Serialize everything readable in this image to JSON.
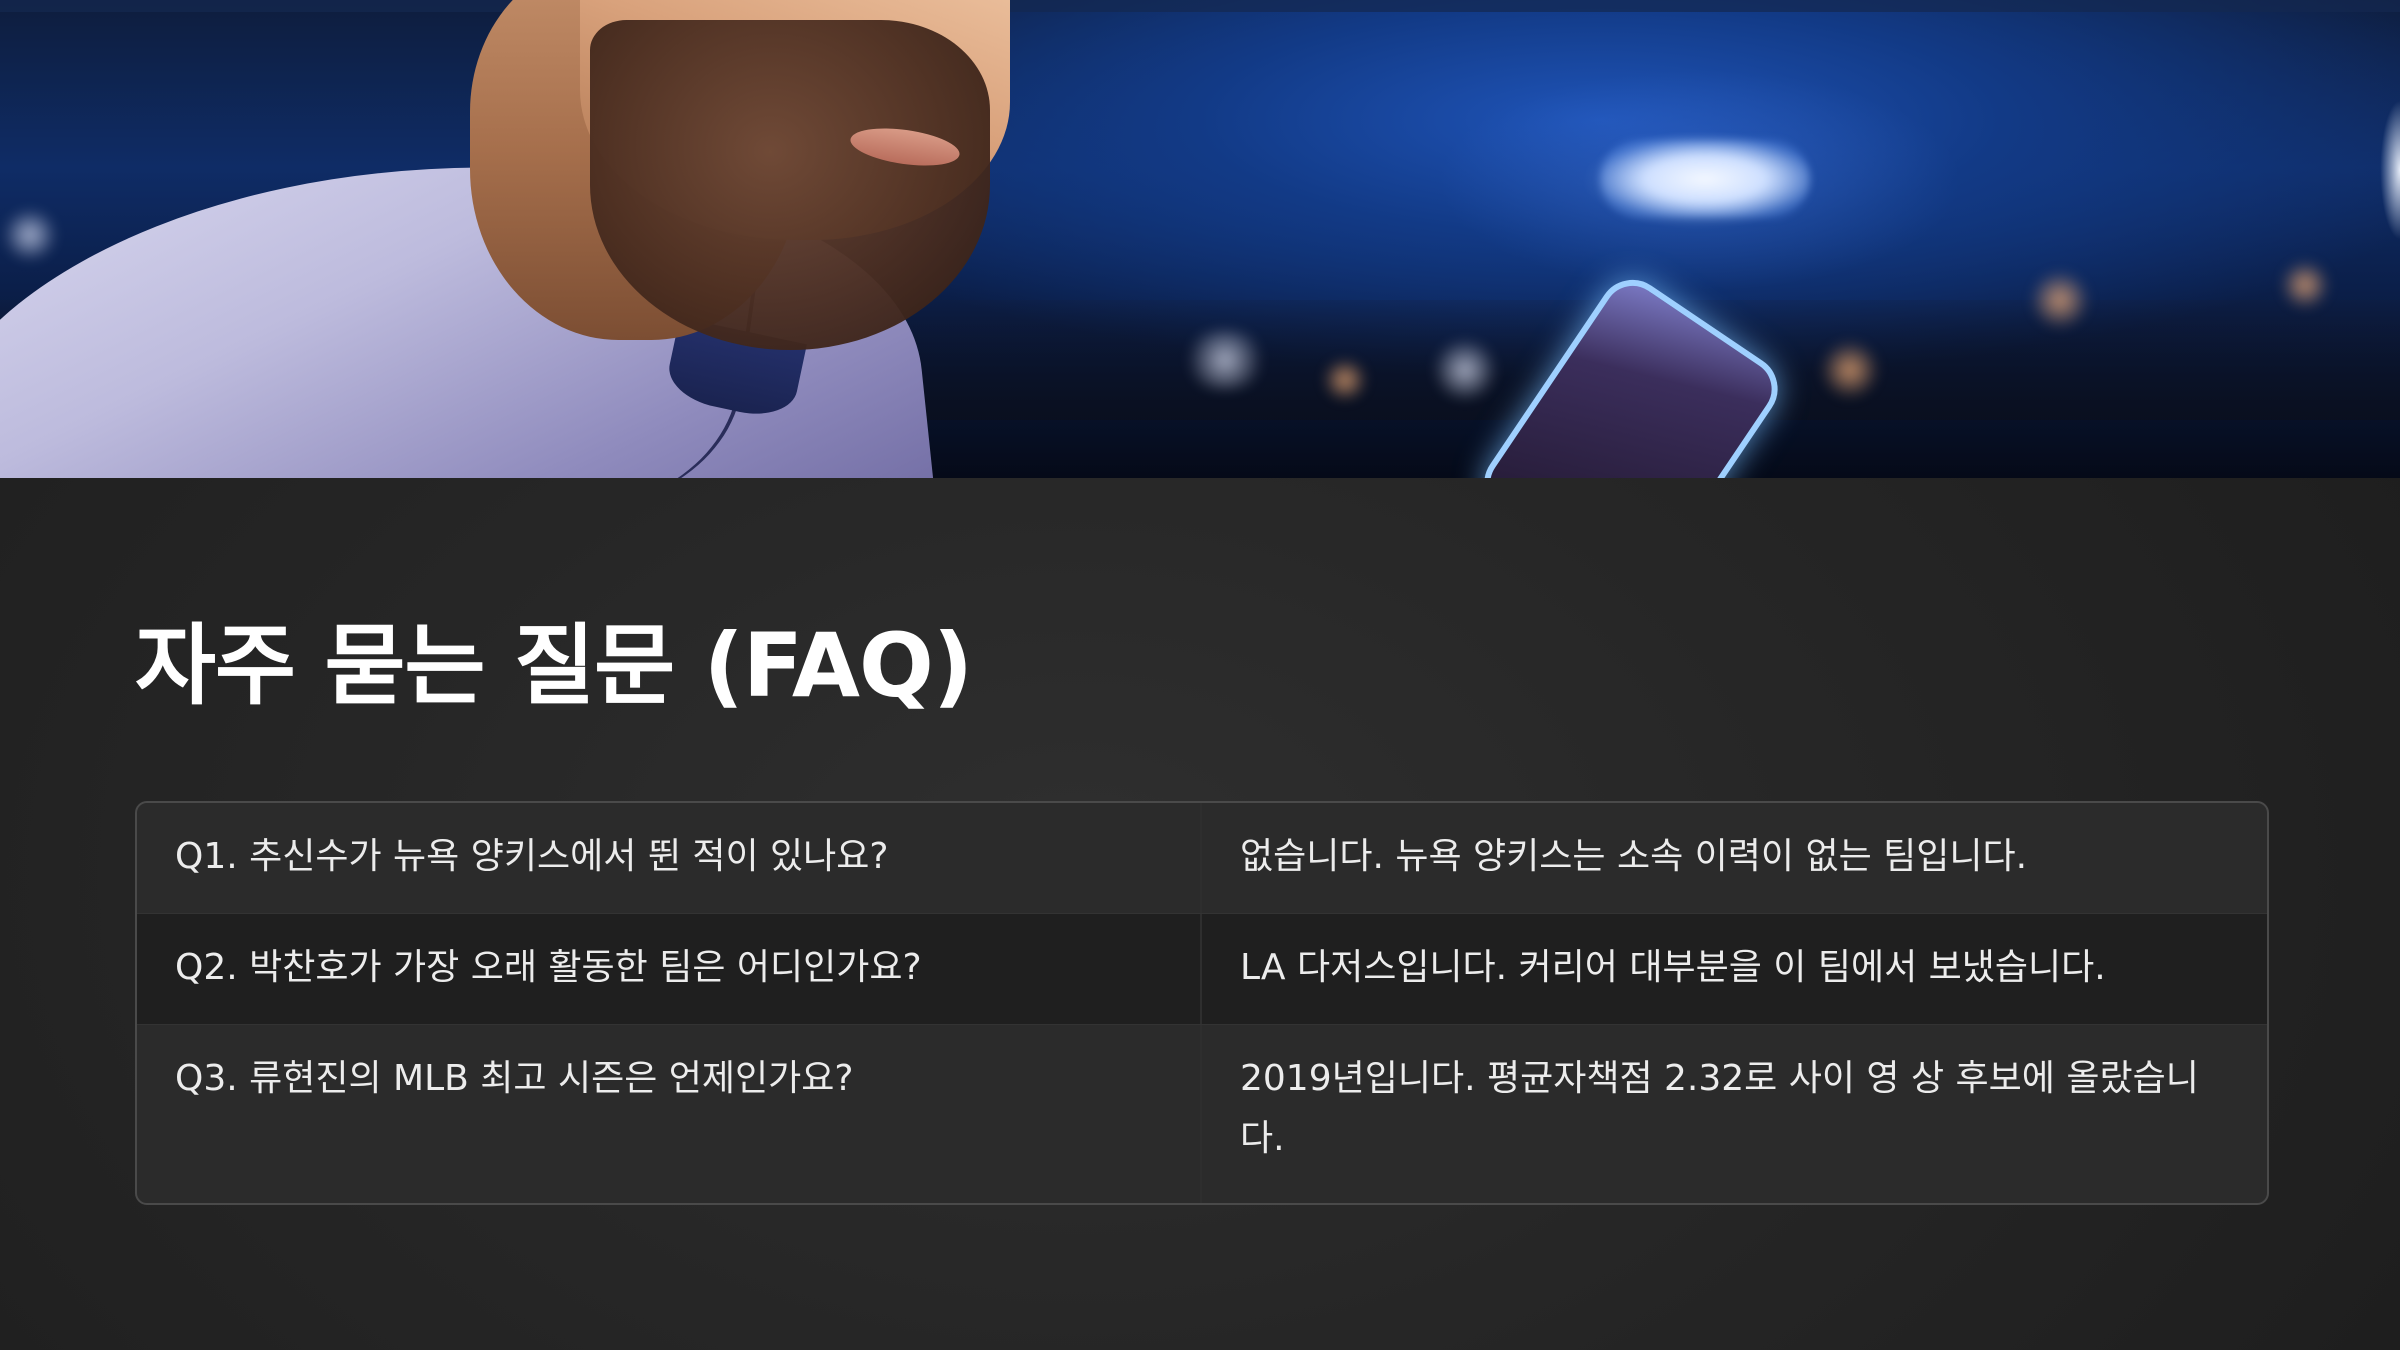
{
  "hero": {
    "image": "baseball-player-looking-at-phone-in-stadium",
    "colors": {
      "sky": "#1f54b8",
      "jersey": "#c9c7e6",
      "floodlight": "#f4f8ff"
    }
  },
  "page": {
    "title": "자주 묻는 질문 (FAQ)"
  },
  "faq": {
    "rows": [
      {
        "question": "Q1. 추신수가 뉴욕 양키스에서 뛴 적이 있나요?",
        "answer": "없습니다. 뉴욕 양키스는 소속 이력이 없는 팀입니다."
      },
      {
        "question": "Q2. 박찬호가 가장 오래 활동한 팀은 어디인가요?",
        "answer": "LA 다저스입니다. 커리어 대부분을 이 팀에서 보냈습니다."
      },
      {
        "question": "Q3. 류현진의 MLB 최고 시즌은 언제인가요?",
        "answer": "2019년입니다. 평균자책점 2.32로 사이 영 상 후보에 올랐습니다."
      }
    ]
  }
}
